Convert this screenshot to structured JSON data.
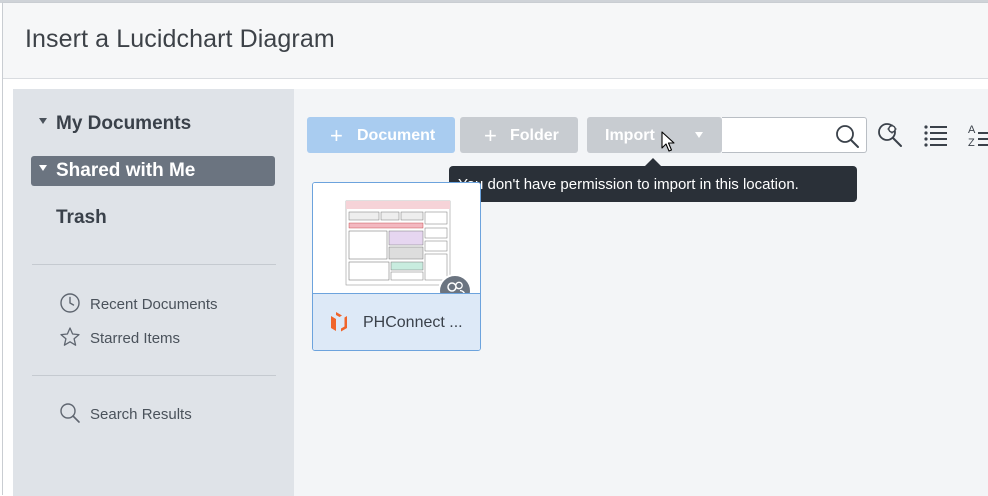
{
  "dialog": {
    "title": "Insert a Lucidchart Diagram"
  },
  "sidebar": {
    "tree": [
      {
        "label": "My Documents",
        "caret": true,
        "active": false
      },
      {
        "label": "Shared with Me",
        "caret": true,
        "active": true
      },
      {
        "label": "Trash",
        "caret": false,
        "active": false
      }
    ],
    "links": [
      {
        "label": "Recent Documents",
        "icon": "clock-icon"
      },
      {
        "label": "Starred Items",
        "icon": "star-icon"
      }
    ],
    "search_link": {
      "label": "Search Results",
      "icon": "search-icon"
    }
  },
  "toolbar": {
    "document_label": "Document",
    "folder_label": "Folder",
    "import_label": "Import",
    "search_value": "",
    "search_placeholder": ""
  },
  "tooltip": {
    "text": "You don't have permission to import in this location."
  },
  "documents": [
    {
      "name": "PHConnect ...",
      "shared": true
    }
  ],
  "colors": {
    "primary_button": "#a9ccf0",
    "disabled_button": "#c8ccd1",
    "sidebar_active": "#6b7480",
    "card_border": "#6ca3dd",
    "logo_orange": "#f0642a"
  }
}
